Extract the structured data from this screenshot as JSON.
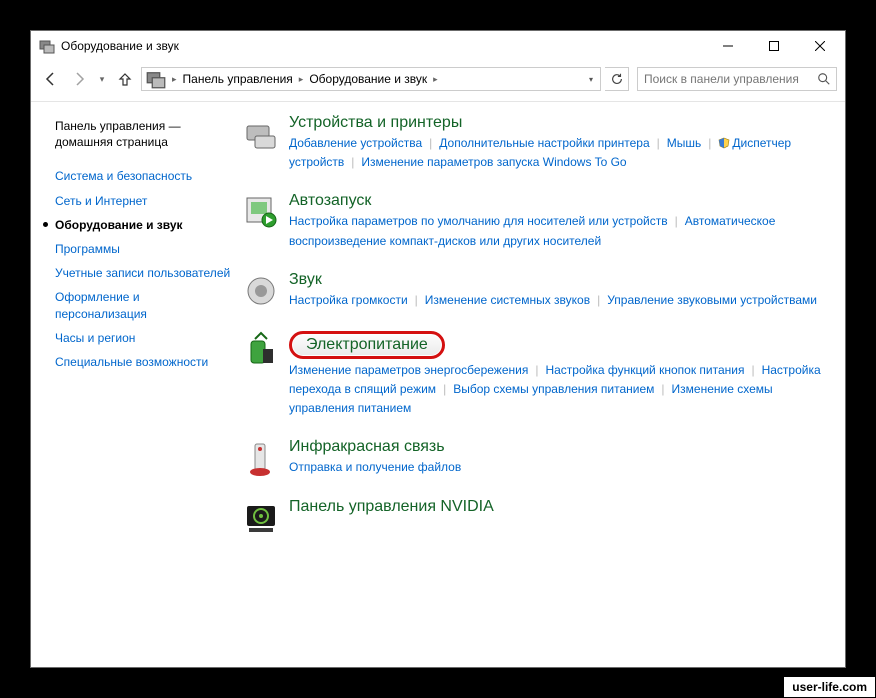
{
  "window": {
    "title": "Оборудование и звук"
  },
  "breadcrumbs": {
    "root": "Панель управления",
    "current": "Оборудование и звук"
  },
  "search": {
    "placeholder": "Поиск в панели управления"
  },
  "sidebar": {
    "home": "Панель управления — домашняя страница",
    "items": [
      "Система и безопасность",
      "Сеть и Интернет",
      "Оборудование и звук",
      "Программы",
      "Учетные записи пользователей",
      "Оформление и персонализация",
      "Часы и регион",
      "Специальные возможности"
    ],
    "active_index": 2
  },
  "categories": [
    {
      "title": "Устройства и принтеры",
      "links": [
        {
          "t": "Добавление устройства"
        },
        {
          "t": "Дополнительные настройки принтера"
        },
        {
          "t": "Мышь"
        },
        {
          "t": "Диспетчер устройств",
          "shield": true
        },
        {
          "t": "Изменение параметров запуска Windows To Go"
        }
      ]
    },
    {
      "title": "Автозапуск",
      "links": [
        {
          "t": "Настройка параметров по умолчанию для носителей или устройств"
        },
        {
          "t": "Автоматическое воспроизведение компакт-дисков или других носителей"
        }
      ]
    },
    {
      "title": "Звук",
      "links": [
        {
          "t": "Настройка громкости"
        },
        {
          "t": "Изменение системных звуков"
        },
        {
          "t": "Управление звуковыми устройствами"
        }
      ]
    },
    {
      "title": "Электропитание",
      "highlighted": true,
      "links": [
        {
          "t": "Изменение параметров энергосбережения"
        },
        {
          "t": "Настройка функций кнопок питания"
        },
        {
          "t": "Настройка перехода в спящий режим"
        },
        {
          "t": "Выбор схемы управления питанием"
        },
        {
          "t": "Изменение схемы управления питанием"
        }
      ]
    },
    {
      "title": "Инфракрасная связь",
      "links": [
        {
          "t": "Отправка и получение файлов"
        }
      ]
    },
    {
      "title": "Панель управления NVIDIA",
      "links": []
    }
  ],
  "badge": "user-life.com"
}
